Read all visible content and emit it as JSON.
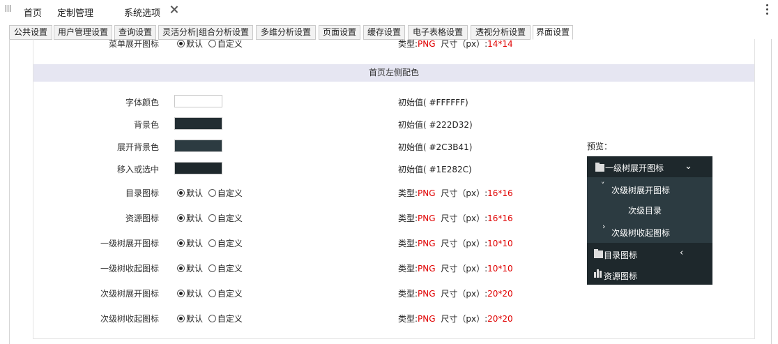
{
  "topbar": {
    "tabs": [
      {
        "label": "首页"
      },
      {
        "label": "定制管理"
      },
      {
        "label": "系统选项"
      }
    ]
  },
  "subtabs": [
    "公共设置",
    "用户管理设置",
    "查询设置",
    "灵活分析|组合分析设置",
    "多维分析设置",
    "页面设置",
    "缓存设置",
    "电子表格设置",
    "透视分析设置",
    "界面设置"
  ],
  "top_row": {
    "label": "菜单展开图标",
    "radio_default": "默认",
    "radio_custom": "自定义",
    "type_prefix": "类型:",
    "type_value": "PNG",
    "size_prefix": "尺寸（px）:",
    "size_value": "14*14"
  },
  "section": {
    "title": "首页左侧配色"
  },
  "colors": [
    {
      "label": "字体颜色",
      "initial": "初始值( #FFFFFF)",
      "swatch": "#ffffff"
    },
    {
      "label": "背景色",
      "initial": "初始值( #222D32)",
      "swatch": "#222d32"
    },
    {
      "label": "展开背景色",
      "initial": "初始值( #2C3B41)",
      "swatch": "#2c3b41"
    },
    {
      "label": "移入或选中",
      "initial": "初始值( #1E282C)",
      "swatch": "#1e282c"
    }
  ],
  "icons": [
    {
      "label": "目录图标",
      "size": "16*16"
    },
    {
      "label": "资源图标",
      "size": "16*16"
    },
    {
      "label": "一级树展开图标",
      "size": "10*10"
    },
    {
      "label": "一级树收起图标",
      "size": "10*10"
    },
    {
      "label": "次级树展开图标",
      "size": "20*20"
    },
    {
      "label": "次级树收起图标",
      "size": "20*20"
    }
  ],
  "radio": {
    "default": "默认",
    "custom": "自定义"
  },
  "type_prefix": "类型:",
  "type_value": "PNG",
  "size_prefix": "尺寸（px）:",
  "preview": {
    "label": "预览：",
    "level1_expand": "一级树展开图标",
    "sub_expand": "次级树展开图标",
    "sub_dir": "次级目录",
    "sub_collapse": "次级树收起图标",
    "dir_icon": "目录图标",
    "res_icon": "资源图标"
  }
}
